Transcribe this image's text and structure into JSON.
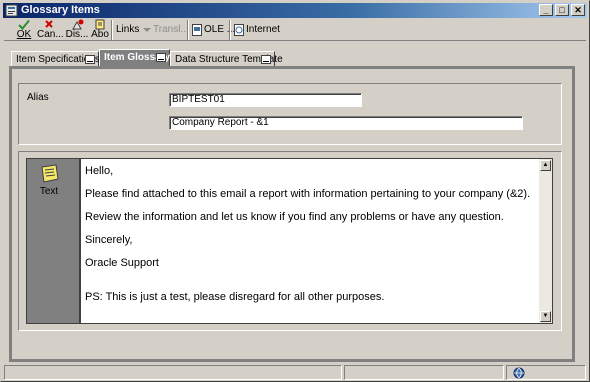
{
  "window": {
    "title": "Glossary Items",
    "controls": {
      "minimize": "_",
      "maximize": "□",
      "close": "✕"
    }
  },
  "toolbar": {
    "ok_label": "OK",
    "cancel_label": "Can...",
    "display_label": "Dis...",
    "about_label": "Abo",
    "links_label": "Links",
    "translate_label": "Transl...",
    "ole_label": "OLE ...",
    "internet_label": "Internet"
  },
  "tabs": [
    {
      "label": "Item Specifications",
      "active": false
    },
    {
      "label": "Item Glossary",
      "active": true
    },
    {
      "label": "Data Structure Template",
      "active": false
    }
  ],
  "form": {
    "alias_label": "Alias",
    "alias_value": "BIPTEST01",
    "description_value": "Company Report - &1"
  },
  "editor": {
    "side_label": "Text",
    "lines": [
      "Hello,",
      "Please find attached to this email a report with information pertaining to your company (&2).",
      "Review the information and let us know if you find any problems or have any question.",
      "Sincerely,",
      "Oracle Support",
      "",
      "PS: This is just a test, please disregard for all other purposes."
    ]
  },
  "colors": {
    "title_bar": "#0a246a",
    "chrome": "#d4d0c8",
    "active_tab": "#808080",
    "ok_check": "#2e8b2e",
    "cancel_x": "#d00000"
  }
}
